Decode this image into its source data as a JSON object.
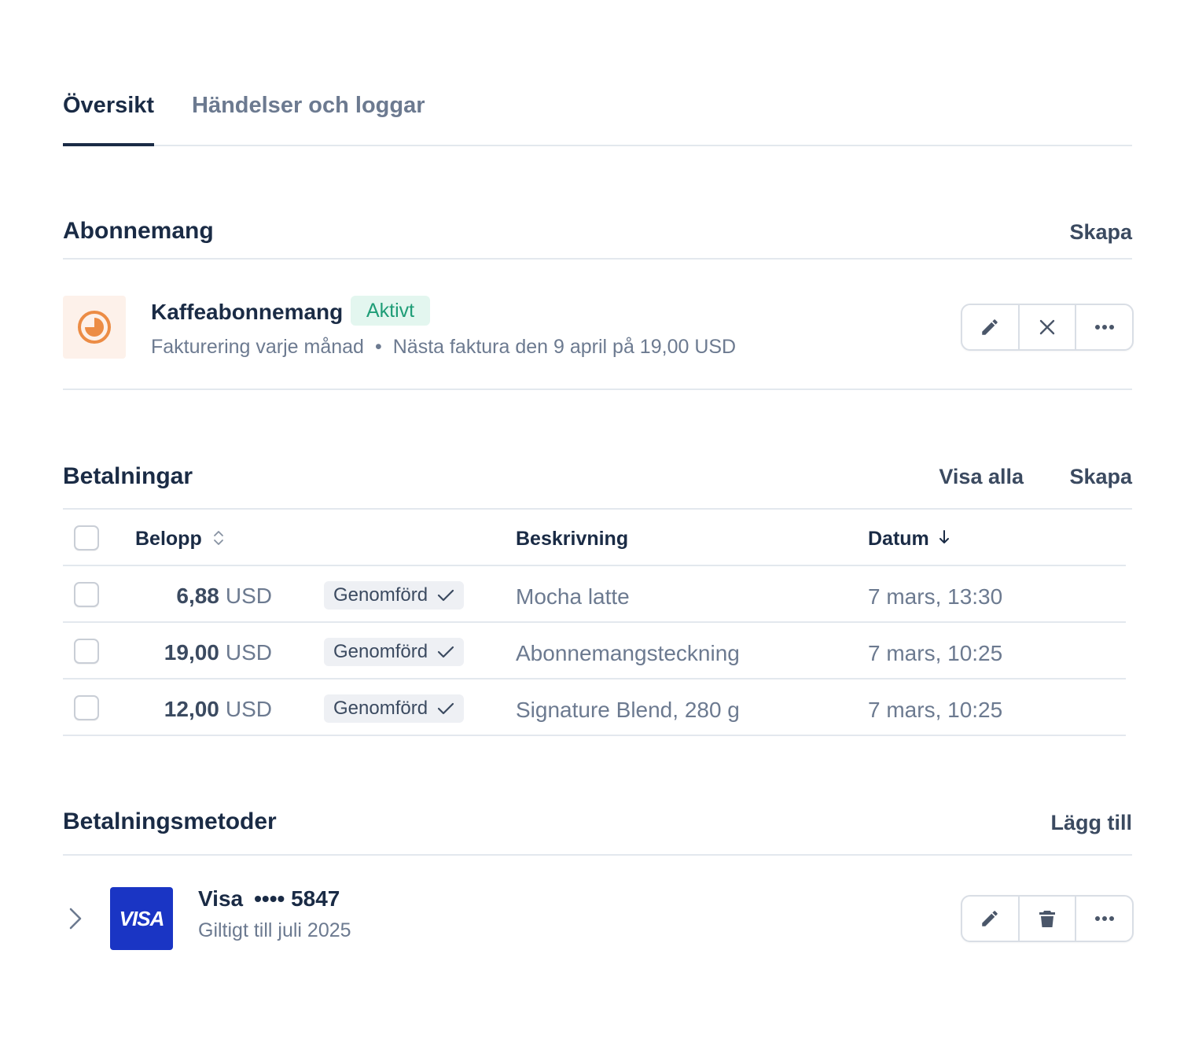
{
  "tabs": [
    {
      "label": "Översikt",
      "active": true
    },
    {
      "label": "Händelser och loggar",
      "active": false
    }
  ],
  "subscriptions": {
    "title": "Abonnemang",
    "create_label": "Skapa",
    "item": {
      "name": "Kaffeabonnemang",
      "status": "Aktivt",
      "billing": "Fakturering varje månad",
      "next_invoice": "Nästa faktura den 9 april på 19,00 USD",
      "icon": "subscription-clock-icon",
      "actions": [
        "edit-icon",
        "cancel-icon",
        "more-icon"
      ]
    }
  },
  "payments": {
    "title": "Betalningar",
    "view_all_label": "Visa alla",
    "create_label": "Skapa",
    "columns": {
      "amount": "Belopp",
      "description": "Beskrivning",
      "date": "Datum"
    },
    "rows": [
      {
        "amount": "6,88",
        "currency": "USD",
        "status": "Genomförd",
        "description": "Mocha latte",
        "date": "7 mars, 13:30"
      },
      {
        "amount": "19,00",
        "currency": "USD",
        "status": "Genomförd",
        "description": "Abonnemangsteckning",
        "date": "7 mars, 10:25"
      },
      {
        "amount": "12,00",
        "currency": "USD",
        "status": "Genomförd",
        "description": "Signature Blend, 280 g",
        "date": "7 mars, 10:25"
      }
    ]
  },
  "payment_methods": {
    "title": "Betalningsmetoder",
    "add_label": "Lägg till",
    "item": {
      "brand": "Visa",
      "masked": "•••• 5847",
      "logo_text": "VISA",
      "expiry": "Giltigt till juli 2025",
      "actions": [
        "edit-icon",
        "trash-icon",
        "more-icon"
      ]
    }
  },
  "colors": {
    "text_primary": "#1a2b45",
    "text_secondary": "#6c7a90",
    "active_badge_bg": "#e3f6ef",
    "active_badge_text": "#1f9d77",
    "visa_blue": "#1a35c4",
    "subscription_icon": "#ec8c45"
  }
}
